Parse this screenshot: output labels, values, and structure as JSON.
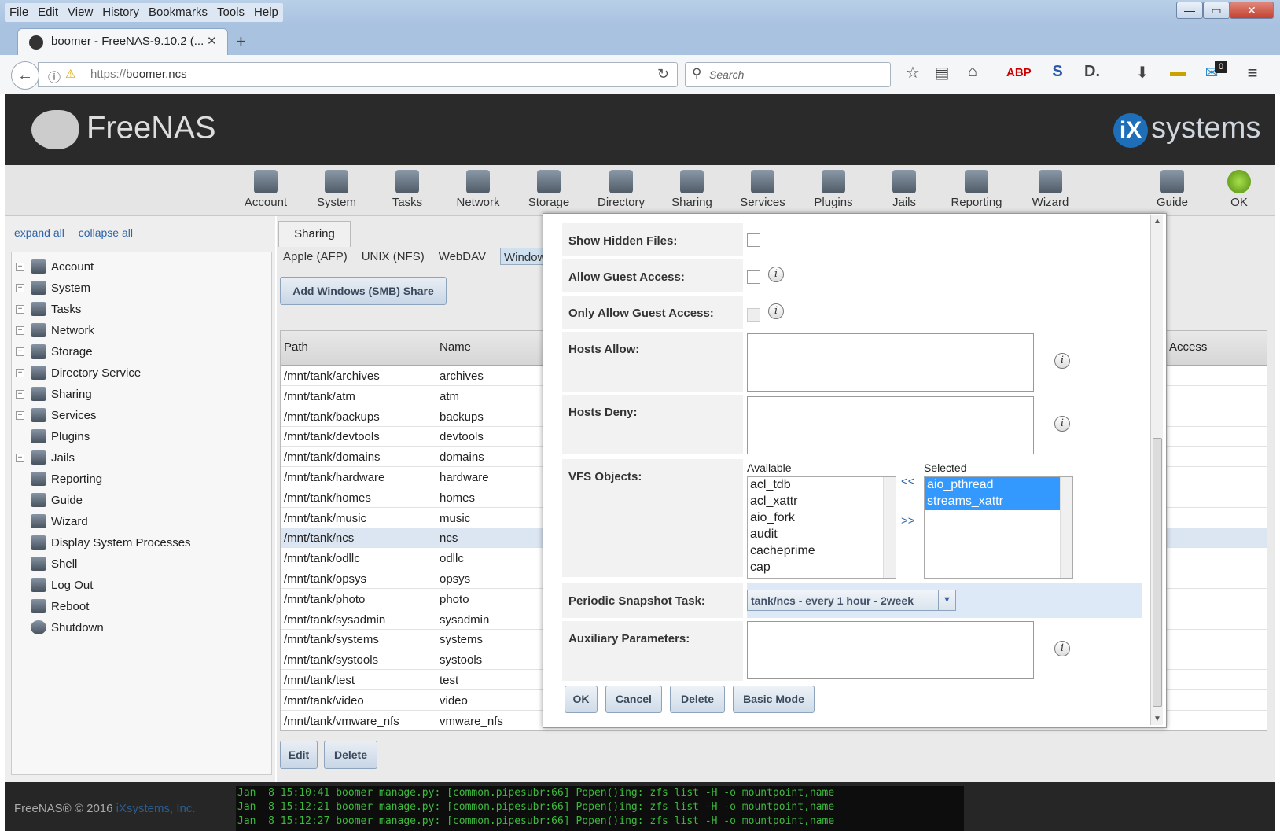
{
  "browser": {
    "menu": [
      "File",
      "Edit",
      "View",
      "History",
      "Bookmarks",
      "Tools",
      "Help"
    ],
    "tab_title": "boomer - FreeNAS-9.10.2 (...",
    "url_prefix": "https://",
    "url_host": "boomer.ncs",
    "search_placeholder": "Search",
    "notification_count": "0",
    "window_buttons": [
      "—",
      "▭",
      "✕"
    ]
  },
  "header": {
    "logo_text": "FreeNAS",
    "vendor_text": "systems"
  },
  "topnav": [
    "Account",
    "System",
    "Tasks",
    "Network",
    "Storage",
    "Directory",
    "Sharing",
    "Services",
    "Plugins",
    "Jails",
    "Reporting",
    "Wizard",
    "Guide",
    "OK"
  ],
  "sidebar": {
    "expand_all": "expand all",
    "collapse_all": "collapse all",
    "items": [
      {
        "label": "Account",
        "expandable": true
      },
      {
        "label": "System",
        "expandable": true
      },
      {
        "label": "Tasks",
        "expandable": true
      },
      {
        "label": "Network",
        "expandable": true
      },
      {
        "label": "Storage",
        "expandable": true
      },
      {
        "label": "Directory Service",
        "expandable": true
      },
      {
        "label": "Sharing",
        "expandable": true
      },
      {
        "label": "Services",
        "expandable": true
      },
      {
        "label": "Plugins",
        "expandable": false
      },
      {
        "label": "Jails",
        "expandable": true
      },
      {
        "label": "Reporting",
        "expandable": false
      },
      {
        "label": "Guide",
        "expandable": false
      },
      {
        "label": "Wizard",
        "expandable": false
      },
      {
        "label": "Display System Processes",
        "expandable": false
      },
      {
        "label": "Shell",
        "expandable": false
      },
      {
        "label": "Log Out",
        "expandable": false
      },
      {
        "label": "Reboot",
        "expandable": false
      },
      {
        "label": "Shutdown",
        "expandable": false
      }
    ]
  },
  "content": {
    "tab": "Sharing",
    "subtabs": [
      "Apple (AFP)",
      "UNIX (NFS)",
      "WebDAV",
      "Window"
    ],
    "add_button": "Add Windows (SMB) Share",
    "columns": {
      "path": "Path",
      "name": "Name",
      "access": "Access"
    },
    "rows": [
      {
        "path": "/mnt/tank/archives",
        "name": "archives"
      },
      {
        "path": "/mnt/tank/atm",
        "name": "atm"
      },
      {
        "path": "/mnt/tank/backups",
        "name": "backups"
      },
      {
        "path": "/mnt/tank/devtools",
        "name": "devtools"
      },
      {
        "path": "/mnt/tank/domains",
        "name": "domains"
      },
      {
        "path": "/mnt/tank/hardware",
        "name": "hardware"
      },
      {
        "path": "/mnt/tank/homes",
        "name": "homes"
      },
      {
        "path": "/mnt/tank/music",
        "name": "music"
      },
      {
        "path": "/mnt/tank/ncs",
        "name": "ncs",
        "selected": true
      },
      {
        "path": "/mnt/tank/odllc",
        "name": "odllc"
      },
      {
        "path": "/mnt/tank/opsys",
        "name": "opsys"
      },
      {
        "path": "/mnt/tank/photo",
        "name": "photo"
      },
      {
        "path": "/mnt/tank/sysadmin",
        "name": "sysadmin"
      },
      {
        "path": "/mnt/tank/systems",
        "name": "systems"
      },
      {
        "path": "/mnt/tank/systools",
        "name": "systools"
      },
      {
        "path": "/mnt/tank/test",
        "name": "test"
      },
      {
        "path": "/mnt/tank/video",
        "name": "video"
      },
      {
        "path": "/mnt/tank/vmware_nfs",
        "name": "vmware_nfs"
      }
    ],
    "edit_button": "Edit",
    "delete_button": "Delete"
  },
  "modal": {
    "show_hidden_files": "Show Hidden Files:",
    "allow_guest_access": "Allow Guest Access:",
    "only_allow_guest_access": "Only Allow Guest Access:",
    "hosts_allow": "Hosts Allow:",
    "hosts_deny": "Hosts Deny:",
    "vfs_objects": "VFS Objects:",
    "available_label": "Available",
    "selected_label": "Selected",
    "available": [
      "acl_tdb",
      "acl_xattr",
      "aio_fork",
      "audit",
      "cacheprime",
      "cap"
    ],
    "selected": [
      "aio_pthread",
      "streams_xattr"
    ],
    "move_left": "<<",
    "move_right": ">>",
    "periodic_snapshot_task": "Periodic Snapshot Task:",
    "snapshot_value": "tank/ncs - every 1 hour - 2week",
    "auxiliary_parameters": "Auxiliary Parameters:",
    "buttons": {
      "ok": "OK",
      "cancel": "Cancel",
      "delete": "Delete",
      "basic": "Basic Mode"
    }
  },
  "footer": {
    "copyright": "FreeNAS® © 2016",
    "company": "iXsystems, Inc.",
    "log": [
      "Jan  8 15:10:41 boomer manage.py: [common.pipesubr:66] Popen()ing: zfs list -H -o mountpoint,name",
      "Jan  8 15:12:21 boomer manage.py: [common.pipesubr:66] Popen()ing: zfs list -H -o mountpoint,name",
      "Jan  8 15:12:27 boomer manage.py: [common.pipesubr:66] Popen()ing: zfs list -H -o mountpoint,name"
    ]
  }
}
